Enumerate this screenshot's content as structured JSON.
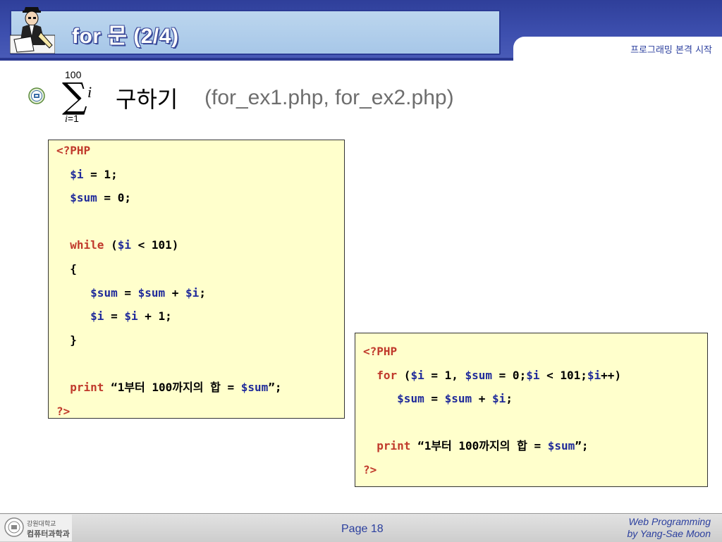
{
  "slide": {
    "title": "for 문 (2/4)",
    "subtitle": "프로그래밍 본격 시작"
  },
  "content": {
    "formula": {
      "upper": "100",
      "sigma": "∑",
      "variable": "i",
      "lower_var": "i",
      "lower_rest": "=1"
    },
    "heading": "구하기",
    "heading_sub": "(for_ex1.php, for_ex2.php)"
  },
  "code_box_1": {
    "lines": [
      [
        {
          "t": "<?PHP",
          "c": "kw"
        }
      ],
      [
        {
          "t": "  "
        },
        {
          "t": "$i",
          "c": "var"
        },
        {
          "t": " = 1;"
        }
      ],
      [
        {
          "t": "  "
        },
        {
          "t": "$sum",
          "c": "var"
        },
        {
          "t": " = 0;"
        }
      ],
      [],
      [
        {
          "t": "  "
        },
        {
          "t": "while",
          "c": "kw"
        },
        {
          "t": " ("
        },
        {
          "t": "$i",
          "c": "var"
        },
        {
          "t": " < 101)"
        }
      ],
      [
        {
          "t": "  {"
        }
      ],
      [
        {
          "t": "     "
        },
        {
          "t": "$sum",
          "c": "var"
        },
        {
          "t": " = "
        },
        {
          "t": "$sum",
          "c": "var"
        },
        {
          "t": " + "
        },
        {
          "t": "$i",
          "c": "var"
        },
        {
          "t": ";"
        }
      ],
      [
        {
          "t": "     "
        },
        {
          "t": "$i",
          "c": "var"
        },
        {
          "t": " = "
        },
        {
          "t": "$i",
          "c": "var"
        },
        {
          "t": " + 1;"
        }
      ],
      [
        {
          "t": "  }"
        }
      ],
      [],
      [
        {
          "t": "  "
        },
        {
          "t": "print",
          "c": "kw"
        },
        {
          "t": " “1부터 100까지의 합 = "
        },
        {
          "t": "$sum",
          "c": "var"
        },
        {
          "t": "”;"
        }
      ],
      [
        {
          "t": "?>",
          "c": "kw"
        }
      ]
    ]
  },
  "code_box_2": {
    "lines": [
      [
        {
          "t": "<?PHP",
          "c": "kw"
        }
      ],
      [
        {
          "t": "  "
        },
        {
          "t": "for",
          "c": "kw"
        },
        {
          "t": " ("
        },
        {
          "t": "$i",
          "c": "var"
        },
        {
          "t": " = 1, "
        },
        {
          "t": "$sum",
          "c": "var"
        },
        {
          "t": " = 0;"
        },
        {
          "t": "$i",
          "c": "var"
        },
        {
          "t": " < 101;"
        },
        {
          "t": "$i",
          "c": "var"
        },
        {
          "t": "++)"
        }
      ],
      [
        {
          "t": "     "
        },
        {
          "t": "$sum",
          "c": "var"
        },
        {
          "t": " = "
        },
        {
          "t": "$sum",
          "c": "var"
        },
        {
          "t": " + "
        },
        {
          "t": "$i",
          "c": "var"
        },
        {
          "t": ";"
        }
      ],
      [],
      [
        {
          "t": "  "
        },
        {
          "t": "print",
          "c": "kw"
        },
        {
          "t": " “1부터 100까지의 합 = "
        },
        {
          "t": "$sum",
          "c": "var"
        },
        {
          "t": "”;"
        }
      ],
      [
        {
          "t": "?>",
          "c": "kw"
        }
      ]
    ]
  },
  "footer": {
    "logo_line1": "강원대학교",
    "logo_line2": "컴퓨터과학과",
    "page": "Page 18",
    "credit_line1": "Web Programming",
    "credit_line2": "by Yang-Sae Moon"
  },
  "colors": {
    "header_blue": "#3d4fae",
    "code_background": "#ffffcc",
    "keyword": "#c0392b",
    "variable": "#1f2a9a"
  },
  "icons": {
    "header_logo": "professor-at-desk-icon",
    "bullet": "university-emblem-icon"
  }
}
